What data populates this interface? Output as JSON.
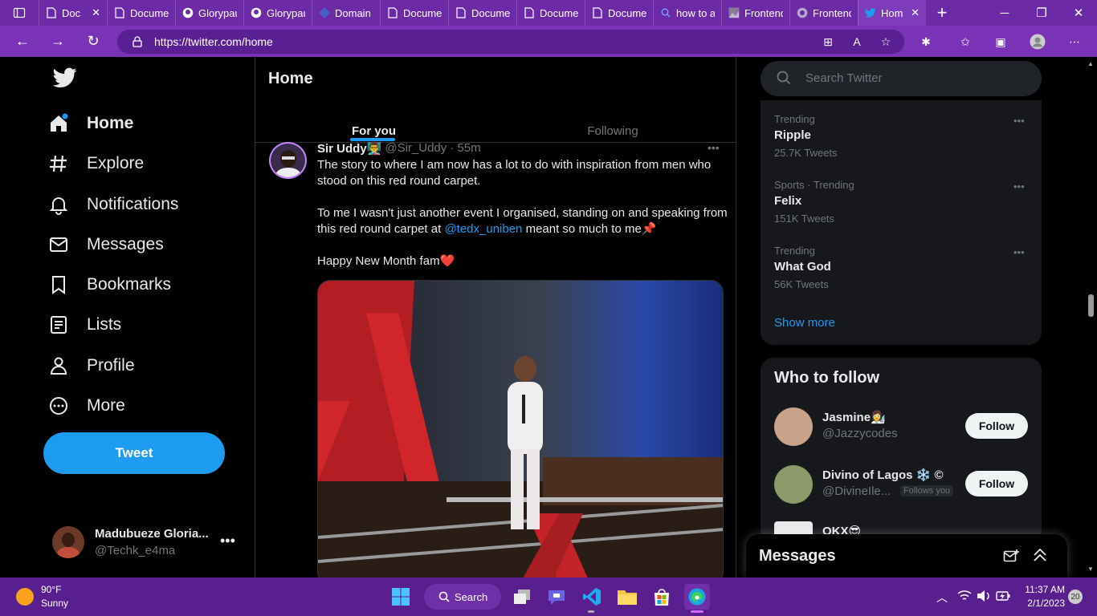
{
  "browser": {
    "tabs": [
      {
        "label": "Doc",
        "icon": "document-icon"
      },
      {
        "label": "Documen",
        "icon": "document-icon"
      },
      {
        "label": "Glorypau",
        "icon": "github-icon"
      },
      {
        "label": "Glorypau",
        "icon": "github-icon"
      },
      {
        "label": "Domain n",
        "icon": "diamond-icon"
      },
      {
        "label": "Documen",
        "icon": "document-icon"
      },
      {
        "label": "Documen",
        "icon": "document-icon"
      },
      {
        "label": "Documen",
        "icon": "document-icon"
      },
      {
        "label": "Documen",
        "icon": "document-icon"
      },
      {
        "label": "how to a",
        "icon": "search-icon"
      },
      {
        "label": "Frontend",
        "icon": "image-icon"
      },
      {
        "label": "Frontend",
        "icon": "globe-icon"
      },
      {
        "label": "Hom",
        "icon": "twitter-icon"
      }
    ],
    "url": "https://twitter.com/home",
    "accent": "#6c2aa6"
  },
  "sidebar": {
    "items": [
      {
        "label": "Home",
        "icon": "home-icon"
      },
      {
        "label": "Explore",
        "icon": "hashtag-icon"
      },
      {
        "label": "Notifications",
        "icon": "bell-icon"
      },
      {
        "label": "Messages",
        "icon": "envelope-icon"
      },
      {
        "label": "Bookmarks",
        "icon": "bookmark-icon"
      },
      {
        "label": "Lists",
        "icon": "list-icon"
      },
      {
        "label": "Profile",
        "icon": "person-icon"
      },
      {
        "label": "More",
        "icon": "more-circle-icon"
      }
    ],
    "tweet_label": "Tweet",
    "account": {
      "name": "Madubueze Gloria...",
      "handle": "@Techk_e4ma"
    }
  },
  "main": {
    "title": "Home",
    "tabs": [
      {
        "label": "For you"
      },
      {
        "label": "Following"
      }
    ],
    "tweet": {
      "author": "Sir Uddy👨‍🏫",
      "handle": "@Sir_Uddy",
      "time": "· 55m",
      "p1": "The story to where I am now has a lot to do with inspiration from men who stood on this red round carpet.",
      "p2_before": "To me I wasn't just another event I organised, standing on and speaking from this red round carpet at ",
      "p2_link": "@tedx_uniben",
      "p2_after": " meant so much to me📌",
      "p3": "Happy New Month fam❤️"
    }
  },
  "right": {
    "search_placeholder": "Search Twitter",
    "trends": [
      {
        "meta": "Trending",
        "name": "Ripple",
        "count": "25.7K Tweets"
      },
      {
        "meta": "Sports · Trending",
        "name": "Felix",
        "count": "151K Tweets"
      },
      {
        "meta": "Trending",
        "name": "What God",
        "count": "56K Tweets"
      }
    ],
    "show_more": "Show more",
    "who_to_follow": "Who to follow",
    "follow_list": [
      {
        "name": "Jasmine👩‍🔬",
        "handle": "@Jazzycodes",
        "badge": "",
        "button": "Follow"
      },
      {
        "name": "Divino of Lagos ❄️ ©",
        "handle": "@DivineIle...",
        "badge": "Follows you",
        "button": "Follow"
      },
      {
        "name": "OKX😎",
        "handle": "",
        "badge": "",
        "button": ""
      }
    ],
    "messages_title": "Messages"
  },
  "taskbar": {
    "weather_temp": "90°F",
    "weather_desc": "Sunny",
    "search_label": "Search",
    "time": "11:37 AM",
    "date": "2/1/2023",
    "notif_count": "20"
  }
}
